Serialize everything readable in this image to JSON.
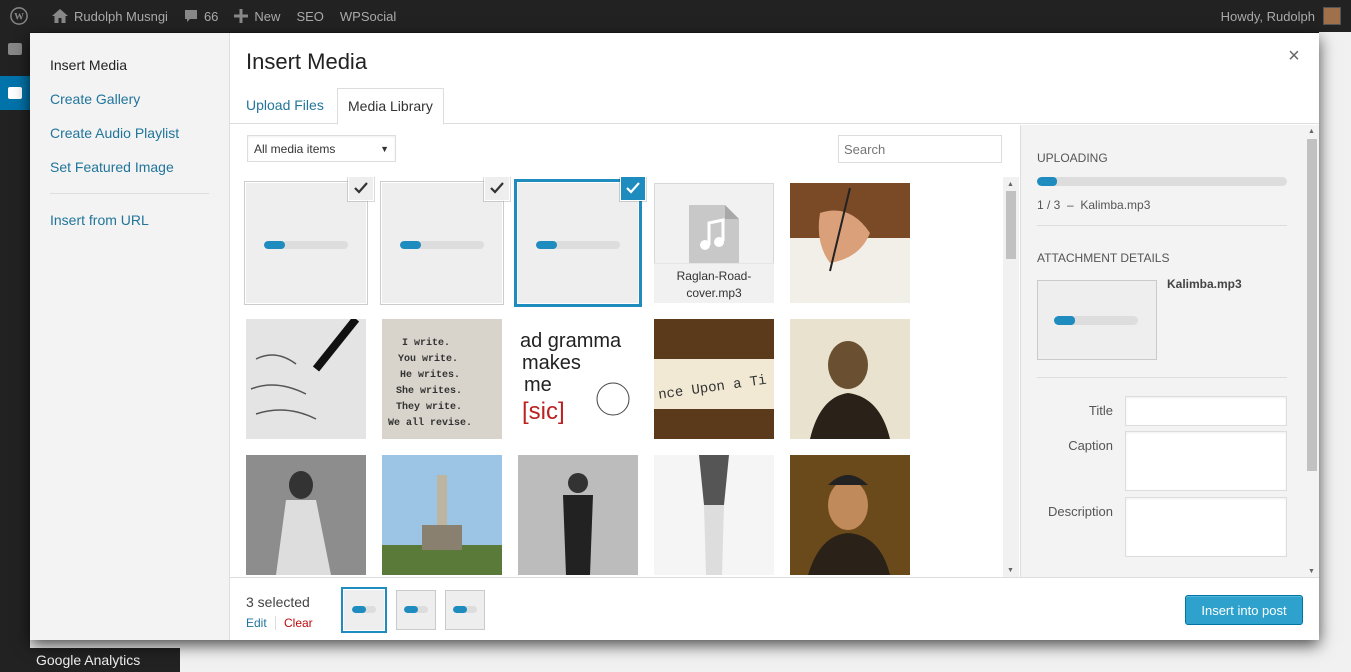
{
  "adminbar": {
    "site": "Rudolph Musngi",
    "comments": "66",
    "new": "New",
    "seo": "SEO",
    "wpsocial": "WPSocial",
    "howdy": "Howdy, Rudolph"
  },
  "bottom_menu": {
    "analytics": "Google Analytics"
  },
  "menu": {
    "items": [
      "Insert Media",
      "Create Gallery",
      "Create Audio Playlist",
      "Set Featured Image"
    ],
    "url": "Insert from URL"
  },
  "title": "Insert Media",
  "close": "×",
  "tabs": [
    "Upload Files",
    "Media Library"
  ],
  "filter": {
    "selected": "All media items",
    "caret": "▼"
  },
  "search": {
    "placeholder": "Search"
  },
  "grid": {
    "file_name": "Raglan-Road-cover.mp3",
    "uploading_progress": 0.25
  },
  "sidebar": {
    "uploading": "UPLOADING",
    "progress": "1 / 3  –  Kalimba.mp3",
    "progress_fraction": 0.08,
    "details": "ATTACHMENT DETAILS",
    "file": "Kalimba.mp3",
    "labels": {
      "title": "Title",
      "caption": "Caption",
      "description": "Description"
    }
  },
  "footer": {
    "count": "3 selected",
    "edit": "Edit",
    "clear": "Clear",
    "insert": "Insert into post"
  },
  "colors": {
    "accent": "#1e8cbe",
    "button": "#2ea2cc",
    "clear": "#bc0b0b"
  },
  "icons": [
    "wordpress-icon",
    "home-icon",
    "comment-icon",
    "plus-icon",
    "check-icon",
    "audio-file-icon",
    "scroll-up-icon",
    "scroll-down-icon"
  ]
}
